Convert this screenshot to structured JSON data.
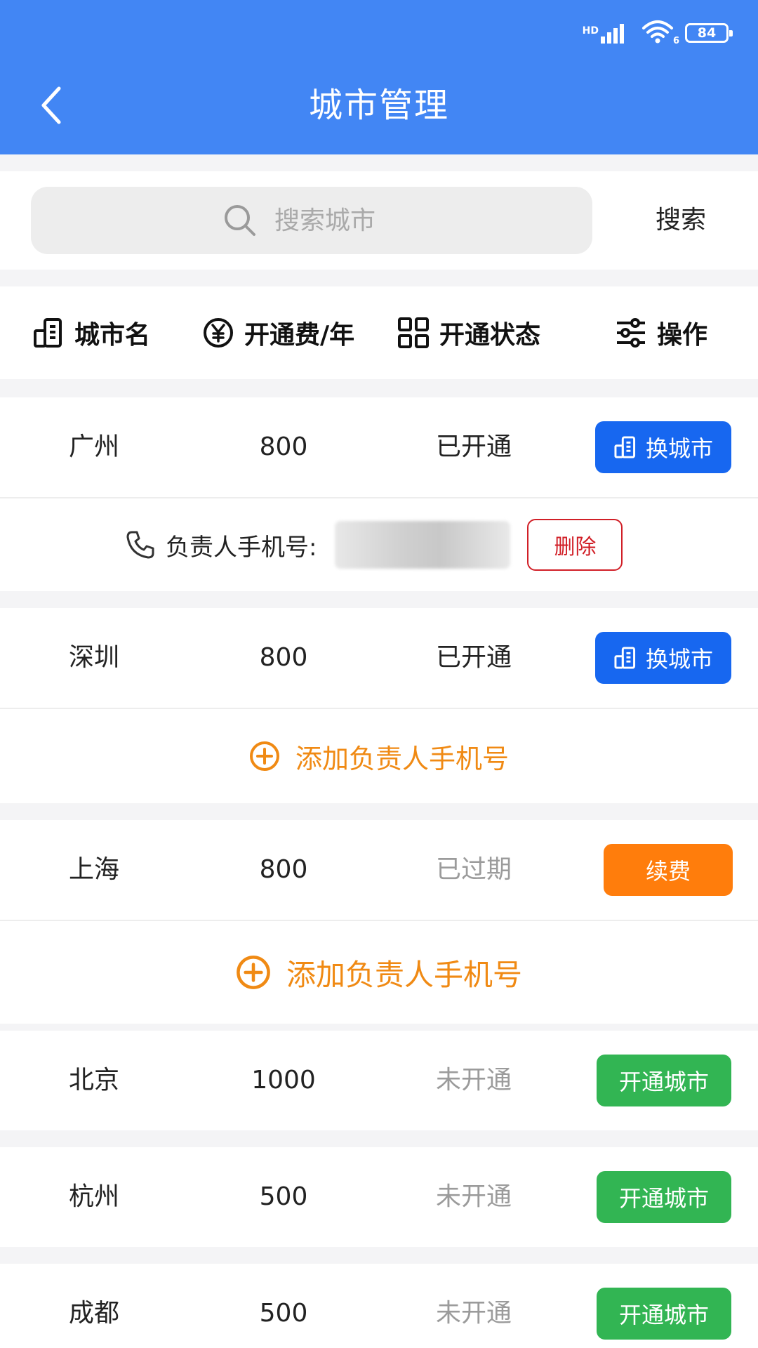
{
  "status_bar": {
    "hd": "HD",
    "wifi_sub": "6",
    "battery": "84"
  },
  "header": {
    "title": "城市管理"
  },
  "search": {
    "placeholder": "搜索城市",
    "button_label": "搜索"
  },
  "columns": [
    {
      "label": "城市名",
      "icon": "building-icon"
    },
    {
      "label": "开通费/年",
      "icon": "yen-coin-icon"
    },
    {
      "label": "开通状态",
      "icon": "grid-icon"
    },
    {
      "label": "操作",
      "icon": "sliders-icon"
    }
  ],
  "cities": [
    {
      "name": "广州",
      "fee": "800",
      "status": "已开通",
      "action": "换城市",
      "contact_label": "负责人手机号:",
      "delete_label": "删除"
    },
    {
      "name": "深圳",
      "fee": "800",
      "status": "已开通",
      "action": "换城市",
      "add_label": "添加负责人手机号"
    },
    {
      "name": "上海",
      "fee": "800",
      "status": "已过期",
      "action": "续费",
      "add_label": "添加负责人手机号"
    },
    {
      "name": "北京",
      "fee": "1000",
      "status": "未开通",
      "action": "开通城市"
    },
    {
      "name": "杭州",
      "fee": "500",
      "status": "未开通",
      "action": "开通城市"
    },
    {
      "name": "成都",
      "fee": "500",
      "status": "未开通",
      "action": "开通城市"
    }
  ],
  "colors": {
    "header": "#4286f4",
    "switch_button": "#1767f0",
    "renew_button": "#ff7d0c",
    "activate_button": "#32b553",
    "delete": "#d11f27",
    "add_contact": "#f08a14",
    "inactive_status": "#9b9b9b"
  }
}
